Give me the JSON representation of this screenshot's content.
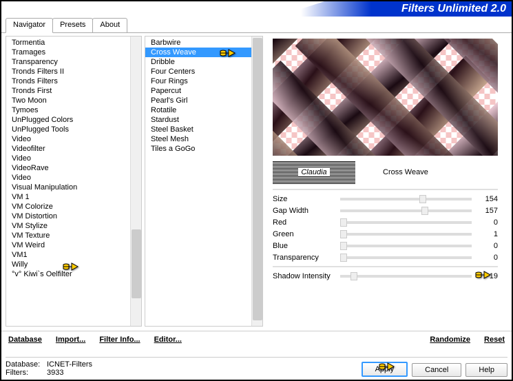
{
  "header": {
    "title": "Filters Unlimited 2.0"
  },
  "tabs": [
    {
      "label": "Navigator",
      "active": true
    },
    {
      "label": "Presets"
    },
    {
      "label": "About"
    }
  ],
  "categories": [
    "Tormentia",
    "Tramages",
    "Transparency",
    "Tronds Filters II",
    "Tronds Filters",
    "Tronds First",
    "Two Moon",
    "Tymoes",
    "UnPlugged Colors",
    "UnPlugged Tools",
    "Video",
    "Videofilter",
    "Video",
    "VideoRave",
    "Video",
    "Visual Manipulation",
    "VM 1",
    "VM Colorize",
    "VM Distortion",
    "VM Stylize",
    "VM Texture",
    "VM Weird",
    "VM1",
    "Willy",
    "°v° Kiwi`s Oelfilter"
  ],
  "selected_category_index": 20,
  "filters": [
    "Barbwire",
    "Cross Weave",
    "Dribble",
    "Four Centers",
    "Four Rings",
    "Papercut",
    "Pearl's Girl",
    "Rotatile",
    "Stardust",
    "Steel Basket",
    "Steel Mesh",
    "Tiles a GoGo"
  ],
  "selected_filter_index": 1,
  "watermark": "Claudia",
  "current_filter": "Cross Weave",
  "params": [
    {
      "name": "Size",
      "value": 154,
      "pos": 60
    },
    {
      "name": "Gap Width",
      "value": 157,
      "pos": 62
    },
    {
      "name": "Red",
      "value": 0,
      "pos": 0
    },
    {
      "name": "Green",
      "value": 1,
      "pos": 0
    },
    {
      "name": "Blue",
      "value": 0,
      "pos": 0
    },
    {
      "name": "Transparency",
      "value": 0,
      "pos": 0
    }
  ],
  "shadow": {
    "name": "Shadow Intensity",
    "value": 19,
    "pos": 8
  },
  "toolbar": {
    "database": "Database",
    "import": "Import...",
    "filterinfo": "Filter Info...",
    "editor": "Editor...",
    "randomize": "Randomize",
    "reset": "Reset"
  },
  "footer": {
    "db_label": "Database:",
    "db_value": "ICNET-Filters",
    "filters_label": "Filters:",
    "filters_value": "3933",
    "apply": "Apply",
    "cancel": "Cancel",
    "help": "Help"
  }
}
